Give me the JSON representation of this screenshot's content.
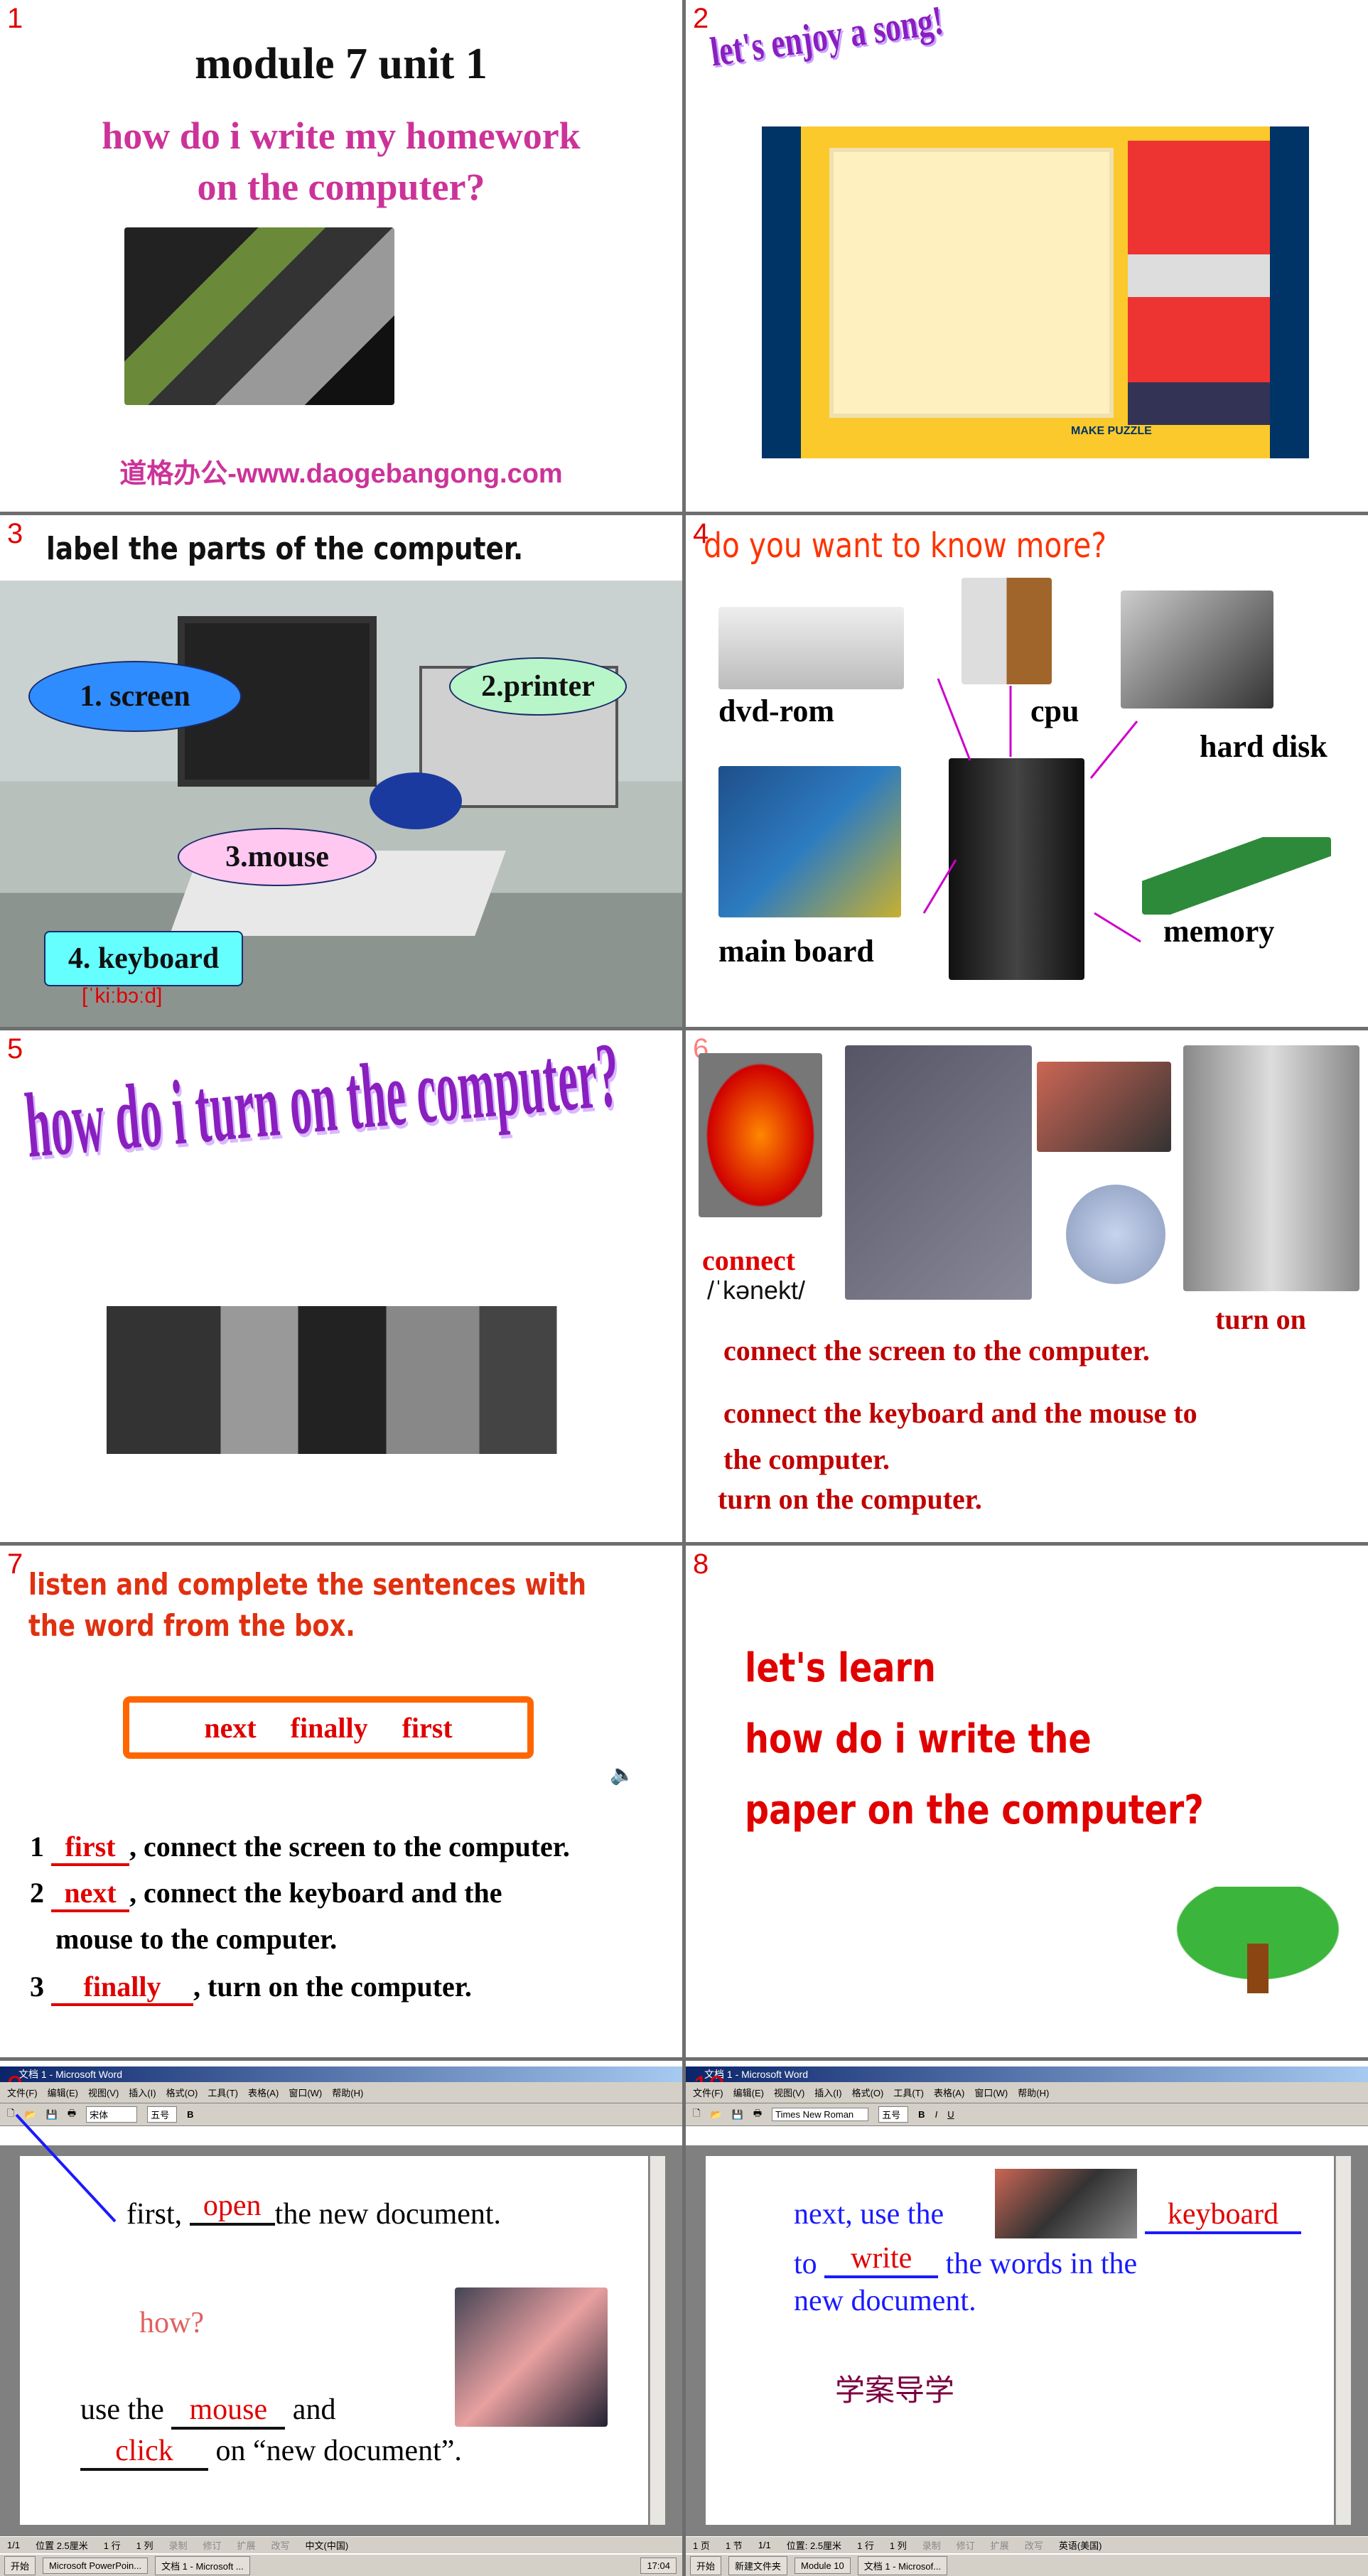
{
  "colors": {
    "slide_number": "#e00000",
    "pink_title": "#cc3399",
    "purple_title": "#8a1fc0",
    "orange_red": "#ff3300",
    "dark_red": "#c00000",
    "blue_text": "#1a1aff",
    "orange_box": "#ff6600"
  },
  "slides": [
    {
      "number": "1",
      "title": "module 7  unit 1",
      "subtitle_line1": "how do i write my homework",
      "subtitle_line2": "on the computer?",
      "website": "道格办公-www.daogebangong.com",
      "image": "computer-set"
    },
    {
      "number": "2",
      "title": "let's enjoy a song!",
      "puzzle_caption": "MAKE PUZZLE",
      "image": "puzzle-video"
    },
    {
      "number": "3",
      "title": "label the parts of the computer.",
      "labels": [
        "1. screen",
        "2.printer",
        "3.mouse",
        "4. keyboard"
      ],
      "phonetic": "[ˈkiːbɔːd]"
    },
    {
      "number": "4",
      "title": "do you want to know more?",
      "parts": [
        "dvd-rom",
        "cpu",
        "hard disk",
        "main board",
        "memory"
      ]
    },
    {
      "number": "5",
      "title": "how do i turn on the computer?"
    },
    {
      "number": "6",
      "word": "connect",
      "phonetic": "/ˈkənekt/",
      "turn_on": "turn on",
      "sentences": [
        "connect the screen to the computer.",
        "connect the keyboard and the mouse to",
        "the computer.",
        "turn on the computer."
      ]
    },
    {
      "number": "7",
      "title_line1": "listen and complete the sentences with",
      "title_line2": "the word from the box.",
      "box_words": [
        "next",
        "finally",
        "first"
      ],
      "items": [
        {
          "n": "1",
          "answer": "first",
          "rest": ", connect the screen to the computer."
        },
        {
          "n": "2",
          "answer": "next",
          "rest": ", connect the keyboard and the"
        },
        {
          "cont": "mouse to the computer."
        },
        {
          "n": "3",
          "answer": "finally",
          "rest": ", turn on the computer."
        }
      ]
    },
    {
      "number": "8",
      "lines": [
        "let's learn",
        "how do i write the",
        "paper on the computer?"
      ]
    },
    {
      "number": "9",
      "window_title": "文档 1 - Microsoft Word",
      "menu": [
        "文件(F)",
        "编辑(E)",
        "视图(V)",
        "插入(I)",
        "格式(O)",
        "工具(T)",
        "表格(A)",
        "窗口(W)",
        "帮助(H)"
      ],
      "font": "宋体",
      "size": "五号",
      "line1_a": "first,",
      "line1_answer": "open",
      "line1_b": "the new document.",
      "how": "how?",
      "line2_a": "use the",
      "line2_answer": "mouse",
      "line2_b": "and",
      "line3_answer": "click",
      "line3_b": "on “new document”.",
      "status": [
        "1/1",
        "位置 2.5厘米",
        "1 行",
        "1 列",
        "录制",
        "修订",
        "扩展",
        "改写",
        "中文(中国)"
      ],
      "taskbar": [
        "开始",
        "Microsoft PowerPoin...",
        "文档 1 - Microsoft ...",
        "17:04"
      ]
    },
    {
      "number": "10",
      "window_title": "文档 1 - Microsoft Word",
      "menu": [
        "文件(F)",
        "编辑(E)",
        "视图(V)",
        "插入(I)",
        "格式(O)",
        "工具(T)",
        "表格(A)",
        "窗口(W)",
        "帮助(H)"
      ],
      "font": "Times New Roman",
      "size": "五号",
      "line1_a": "next, use the",
      "line1_answer": "keyboard",
      "line2_a": "to",
      "line2_answer": "write",
      "line2_b": "the words in the",
      "line3": "new document.",
      "chinese": "学案导学",
      "status": [
        "1 页",
        "1 节",
        "1/1",
        "位置: 2.5厘米",
        "1 行",
        "1 列",
        "录制",
        "修订",
        "扩展",
        "改写",
        "英语(美国)"
      ],
      "taskbar": [
        "开始",
        "新建文件夹",
        "Module 10",
        "文档 1 - Microsof..."
      ]
    }
  ]
}
